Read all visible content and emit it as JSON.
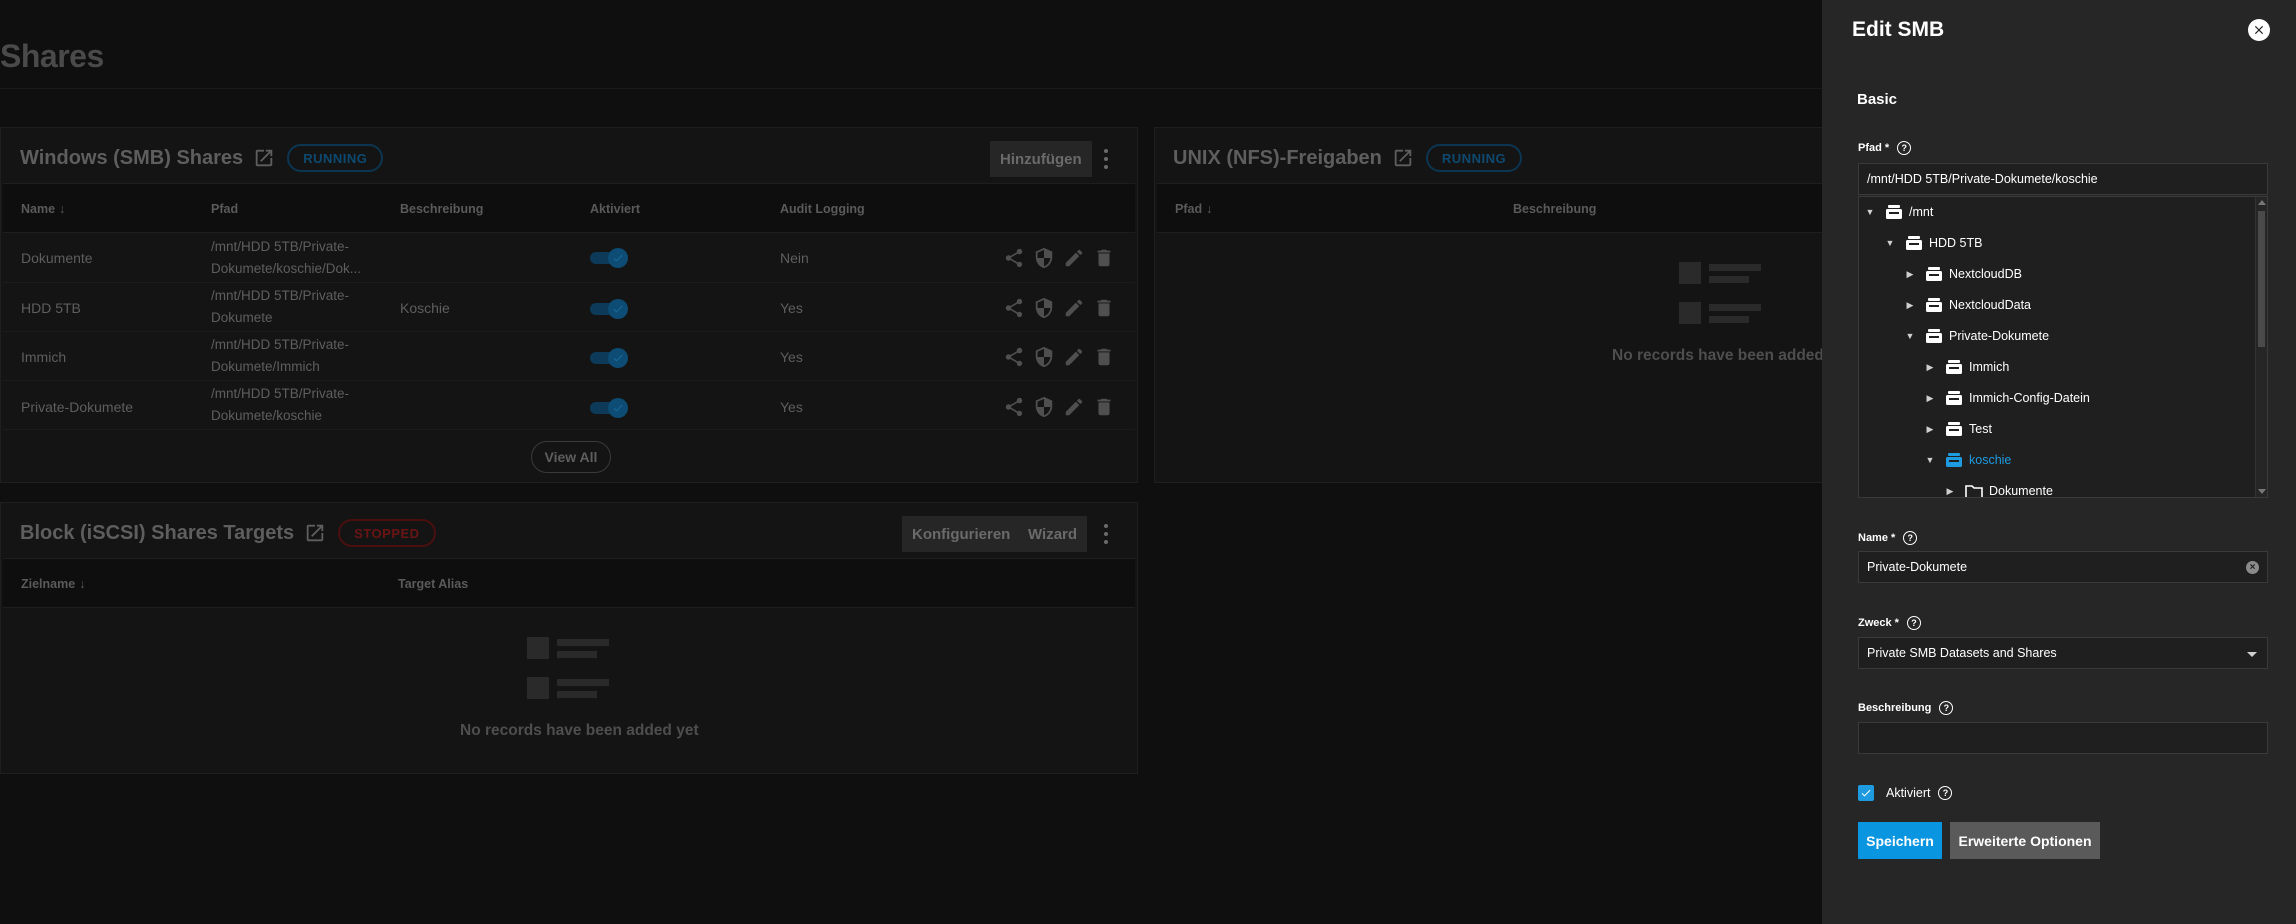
{
  "page": {
    "title": "Shares"
  },
  "smb_card": {
    "title": "Windows (SMB) Shares",
    "status": "RUNNING",
    "add_label": "Hinzufügen",
    "columns": [
      "Name",
      "Pfad",
      "Beschreibung",
      "Aktiviert",
      "Audit Logging"
    ],
    "rows": [
      {
        "name": "Dokumente",
        "path": "/mnt/HDD 5TB/Private-Dokumete/koschie/Dok...",
        "description": "",
        "enabled": true,
        "audit": "Nein"
      },
      {
        "name": "HDD 5TB",
        "path": "/mnt/HDD 5TB/Private-Dokumete",
        "description": "Koschie",
        "enabled": true,
        "audit": "Yes"
      },
      {
        "name": "Immich",
        "path": "/mnt/HDD 5TB/Private-Dokumete/Immich",
        "description": "",
        "enabled": true,
        "audit": "Yes"
      },
      {
        "name": "Private-Dokumete",
        "path": "/mnt/HDD 5TB/Private-Dokumete/koschie",
        "description": "",
        "enabled": true,
        "audit": "Yes"
      }
    ],
    "view_all_label": "View All"
  },
  "nfs_card": {
    "title": "UNIX (NFS)-Freigaben",
    "status": "RUNNING",
    "columns": [
      "Pfad",
      "Beschreibung"
    ],
    "empty_text": "No records have been added yet"
  },
  "iscsi_card": {
    "title": "Block (iSCSI) Shares Targets",
    "status": "STOPPED",
    "configure_label": "Konfigurieren",
    "wizard_label": "Wizard",
    "columns": [
      "Zielname",
      "Target Alias"
    ],
    "empty_text": "No records have been added yet"
  },
  "panel": {
    "title": "Edit SMB",
    "section": "Basic",
    "path_label": "Pfad *",
    "path_value": "/mnt/HDD 5TB/Private-Dokumete/koschie",
    "tree": [
      {
        "label": "/mnt",
        "depth": 0,
        "expanded": true,
        "type": "dataset"
      },
      {
        "label": "HDD 5TB",
        "depth": 1,
        "expanded": true,
        "type": "dataset"
      },
      {
        "label": "NextcloudDB",
        "depth": 2,
        "expanded": false,
        "type": "dataset"
      },
      {
        "label": "NextcloudData",
        "depth": 2,
        "expanded": false,
        "type": "dataset"
      },
      {
        "label": "Private-Dokumete",
        "depth": 2,
        "expanded": true,
        "type": "dataset"
      },
      {
        "label": "Immich",
        "depth": 3,
        "expanded": false,
        "type": "dataset"
      },
      {
        "label": "Immich-Config-Datein",
        "depth": 3,
        "expanded": false,
        "type": "dataset"
      },
      {
        "label": "Test",
        "depth": 3,
        "expanded": false,
        "type": "dataset"
      },
      {
        "label": "koschie",
        "depth": 3,
        "expanded": true,
        "type": "dataset",
        "selected": true
      },
      {
        "label": "Dokumente",
        "depth": 4,
        "expanded": false,
        "type": "folder"
      }
    ],
    "name_label": "Name *",
    "name_value": "Private-Dokumete",
    "purpose_label": "Zweck *",
    "purpose_value": "Private SMB Datasets and Shares",
    "description_label": "Beschreibung",
    "description_value": "",
    "enabled_label": "Aktiviert",
    "enabled": true,
    "save_label": "Speichern",
    "advanced_label": "Erweiterte Optionen"
  },
  "colors": {
    "accent": "#0a95e0",
    "panel_bg": "#262626",
    "page_bg": "#0f0f0f"
  }
}
